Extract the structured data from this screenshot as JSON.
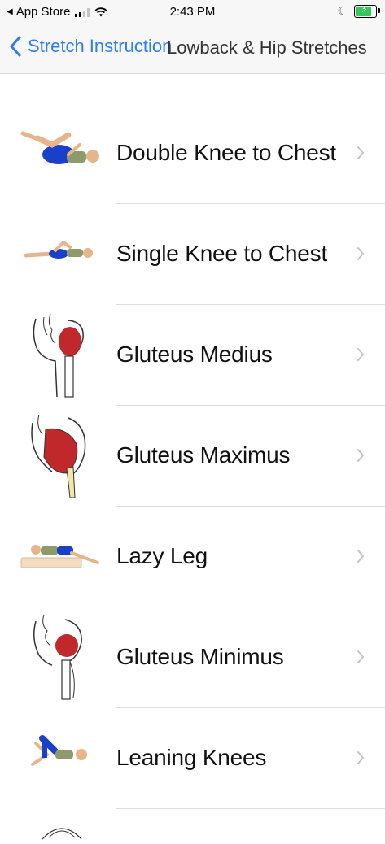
{
  "status_bar": {
    "back_app": "App Store",
    "time": "2:43 PM",
    "battery_percent": 80
  },
  "nav": {
    "back_label": "Stretch Instruction",
    "title": "Lowback & Hip Stretches"
  },
  "colors": {
    "accent": "#2f7cf6",
    "muscle_red": "#c0282c",
    "pants_blue": "#1a3fc8",
    "skin": "#e6b58a",
    "battery_green": "#34c759"
  },
  "list": {
    "items": [
      {
        "label": "Double Knee to Chest",
        "icon": "double-knee-to-chest-figure"
      },
      {
        "label": "Single Knee to Chest",
        "icon": "single-knee-to-chest-figure"
      },
      {
        "label": "Gluteus Medius",
        "icon": "gluteus-medius-anatomy"
      },
      {
        "label": "Gluteus Maximus",
        "icon": "gluteus-maximus-anatomy"
      },
      {
        "label": "Lazy Leg",
        "icon": "lazy-leg-figure"
      },
      {
        "label": "Gluteus Minimus",
        "icon": "gluteus-minimus-anatomy"
      },
      {
        "label": "Leaning Knees",
        "icon": "leaning-knees-figure"
      }
    ]
  }
}
